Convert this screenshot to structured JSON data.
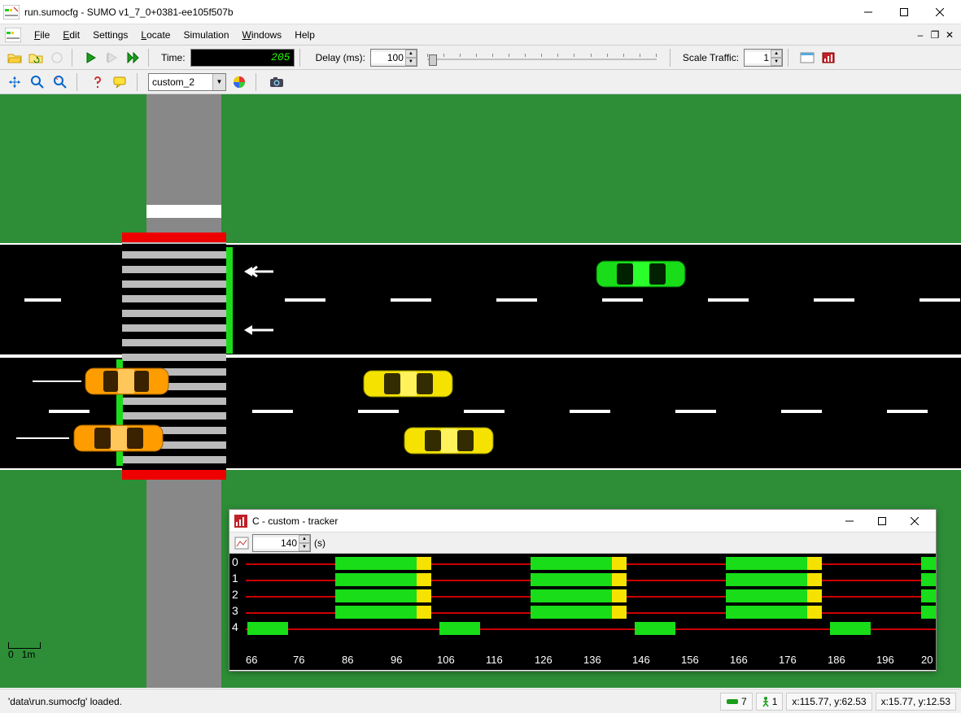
{
  "window": {
    "title": "run.sumocfg - SUMO v1_7_0+0381-ee105f507b"
  },
  "menu": {
    "file": "File",
    "edit": "Edit",
    "settings": "Settings",
    "locate": "Locate",
    "simulation": "Simulation",
    "windows": "Windows",
    "help": "Help"
  },
  "toolbar": {
    "time_label": "Time:",
    "time_value": "205",
    "delay_label": "Delay (ms):",
    "delay_value": "100",
    "scale_label": "Scale Traffic:",
    "scale_value": "1",
    "view_scheme": "custom_2"
  },
  "tracker": {
    "title": "C - custom - tracker",
    "window_value": "140",
    "window_unit": "(s)",
    "row_labels": [
      "0",
      "1",
      "2",
      "3",
      "4"
    ],
    "x_ticks": [
      "66",
      "76",
      "86",
      "96",
      "106",
      "116",
      "126",
      "136",
      "146",
      "156",
      "166",
      "176",
      "186",
      "196",
      "20"
    ]
  },
  "status": {
    "message": "'data\\run.sumocfg' loaded.",
    "vehicle_count": "7",
    "person_count": "1",
    "coord1": "x:115.77, y:62.53",
    "coord2": "x:15.77, y:12.53"
  },
  "scale_ruler": "0   1m"
}
